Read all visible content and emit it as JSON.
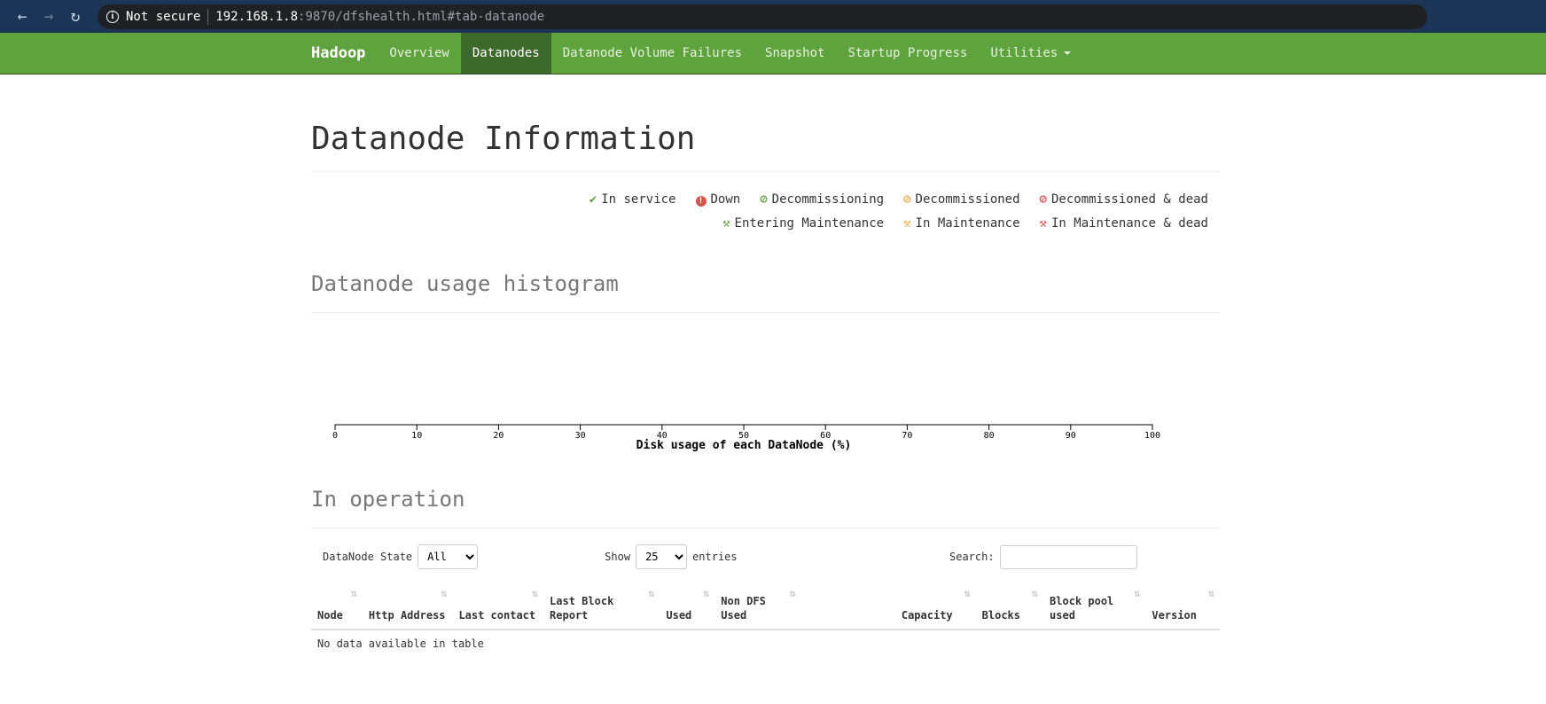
{
  "browser": {
    "security": "Not secure",
    "url_host": "192.168.1.8",
    "url_rest": ":9870/dfshealth.html#tab-datanode"
  },
  "nav": {
    "brand": "Hadoop",
    "items": [
      {
        "label": "Overview"
      },
      {
        "label": "Datanodes",
        "active": true
      },
      {
        "label": "Datanode Volume Failures"
      },
      {
        "label": "Snapshot"
      },
      {
        "label": "Startup Progress"
      },
      {
        "label": "Utilities"
      }
    ]
  },
  "page_title": "Datanode Information",
  "legend": [
    {
      "label": "In service",
      "icon": "check-icon",
      "color": "#5fa33e"
    },
    {
      "label": "Down",
      "icon": "exclamation-circle-icon",
      "color": "#d9534f"
    },
    {
      "label": "Decommissioning",
      "icon": "ban-icon",
      "color": "#5fa33e"
    },
    {
      "label": "Decommissioned",
      "icon": "ban-icon",
      "color": "#f0ad4e"
    },
    {
      "label": "Decommissioned & dead",
      "icon": "ban-icon",
      "color": "#d9534f"
    },
    {
      "label": "Entering Maintenance",
      "icon": "wrench-icon",
      "color": "#5fa33e"
    },
    {
      "label": "In Maintenance",
      "icon": "wrench-icon",
      "color": "#f0ad4e"
    },
    {
      "label": "In Maintenance & dead",
      "icon": "wrench-icon",
      "color": "#d9534f"
    }
  ],
  "histogram_title": "Datanode usage histogram",
  "chart_data": {
    "type": "bar",
    "values": [],
    "xlabel": "Disk usage of each DataNode (%)",
    "xlim": [
      0,
      100
    ],
    "xticks": [
      "0",
      "10",
      "20",
      "30",
      "40",
      "50",
      "60",
      "70",
      "80",
      "90",
      "100"
    ]
  },
  "operation": {
    "title": "In operation",
    "state_label": "DataNode State",
    "state_value": "All",
    "show_label": "Show",
    "show_value": "25",
    "entries_label": "entries",
    "search_label": "Search:",
    "search_value": "",
    "columns": [
      "Node",
      "Http Address",
      "Last contact",
      "Last Block Report",
      "Used",
      "Non DFS Used",
      "Capacity",
      "Blocks",
      "Block pool used",
      "Version"
    ],
    "empty": "No data available in table"
  }
}
